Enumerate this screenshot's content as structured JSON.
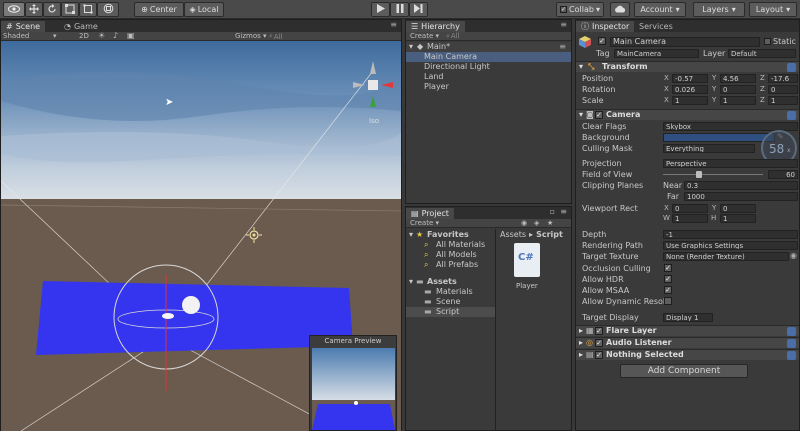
{
  "toolbar": {
    "pivot_label": "Center",
    "space_label": "Local",
    "collab_label": "Collab",
    "account_label": "Account",
    "layers_label": "Layers",
    "layout_label": "Layout"
  },
  "scene": {
    "tab_label": "Scene",
    "game_tab_label": "Game",
    "shading_label": "Shaded",
    "mode_2d": "2D",
    "gizmos_label": "Gizmos",
    "search_placeholder": "All",
    "iso_label": "Iso",
    "camera_preview_title": "Camera Preview"
  },
  "hierarchy": {
    "tab_label": "Hierarchy",
    "create_label": "Create",
    "search_placeholder": "All",
    "scene_name": "Main*",
    "items": [
      "Main Camera",
      "Directional Light",
      "Land",
      "Player"
    ]
  },
  "project": {
    "tab_label": "Project",
    "create_label": "Create",
    "favorites_label": "Favorites",
    "favorites": [
      "All Materials",
      "All Models",
      "All Prefabs"
    ],
    "assets_label": "Assets",
    "asset_folders": [
      "Materials",
      "Scene",
      "Script"
    ],
    "breadcrumb_root": "Assets",
    "breadcrumb_sep": "▸",
    "breadcrumb_leaf": "Script",
    "file_name": "Player",
    "file_icon_text": "C#"
  },
  "inspector": {
    "tab_label": "Inspector",
    "services_tab_label": "Services",
    "object_name": "Main Camera",
    "static_label": "Static",
    "tag_label": "Tag",
    "tag_value": "MainCamera",
    "layer_label": "Layer",
    "layer_value": "Default",
    "transform": {
      "title": "Transform",
      "position_label": "Position",
      "rotation_label": "Rotation",
      "scale_label": "Scale",
      "position": [
        "-0.57",
        "4.56",
        "-17.6"
      ],
      "rotation": [
        "0.026",
        "0",
        "0"
      ],
      "scale": [
        "1",
        "1",
        "1"
      ]
    },
    "camera": {
      "title": "Camera",
      "clear_flags_label": "Clear Flags",
      "clear_flags_value": "Skybox",
      "background_label": "Background",
      "culling_mask_label": "Culling Mask",
      "culling_mask_value": "Everything",
      "projection_label": "Projection",
      "projection_value": "Perspective",
      "fov_label": "Field of View",
      "fov_value": "60",
      "clipping_label": "Clipping Planes",
      "near_label": "Near",
      "near_value": "0.3",
      "far_label": "Far",
      "far_value": "1000",
      "viewport_label": "Viewport Rect",
      "vp_x": "0",
      "vp_y": "0",
      "vp_w": "1",
      "vp_h": "1",
      "depth_label": "Depth",
      "depth_value": "-1",
      "rendering_path_label": "Rendering Path",
      "rendering_path_value": "Use Graphics Settings",
      "target_texture_label": "Target Texture",
      "target_texture_value": "None (Render Texture)",
      "occlusion_label": "Occlusion Culling",
      "hdr_label": "Allow HDR",
      "msaa_label": "Allow MSAA",
      "dynres_label": "Allow Dynamic Resolut",
      "target_display_label": "Target Display",
      "target_display_value": "Display 1"
    },
    "fps_badge": "58",
    "fps_badge_suffix": "x",
    "flare_layer_label": "Flare Layer",
    "audio_listener_label": "Audio Listener",
    "nothing_selected_label": "Nothing Selected",
    "add_component_label": "Add Component"
  },
  "colors": {
    "sky_top": "#3f6d9e",
    "sky_horizon": "#c6d2de",
    "ground": "#6e5d4f",
    "plane_blue": "#3535f0",
    "selection": "#4a5f80"
  }
}
